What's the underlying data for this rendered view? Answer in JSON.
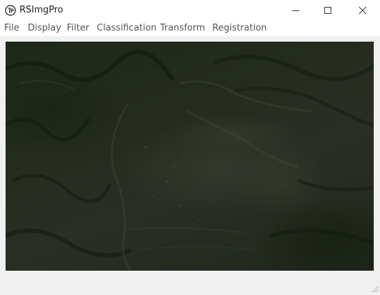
{
  "window": {
    "title": "RSImgPro",
    "icon": "rsimgpro-app-icon",
    "controls": {
      "minimize_icon": "minimize-icon",
      "maximize_icon": "maximize-icon",
      "close_icon": "close-icon"
    }
  },
  "menubar": {
    "items": [
      {
        "label": "File"
      },
      {
        "label": "Display"
      },
      {
        "label": "Filter"
      },
      {
        "label": "Classification"
      },
      {
        "label": "Transform"
      },
      {
        "label": "Registration"
      }
    ]
  },
  "image_view": {
    "content": "remote-sensing-satellite-image"
  },
  "colors": {
    "titlebar": "#ffffff",
    "menubar": "#ffffff",
    "client_background": "#f0f0f0",
    "menu_text": "#555555",
    "title_text": "#1a1a1a",
    "image_dark": "#1e2819"
  }
}
